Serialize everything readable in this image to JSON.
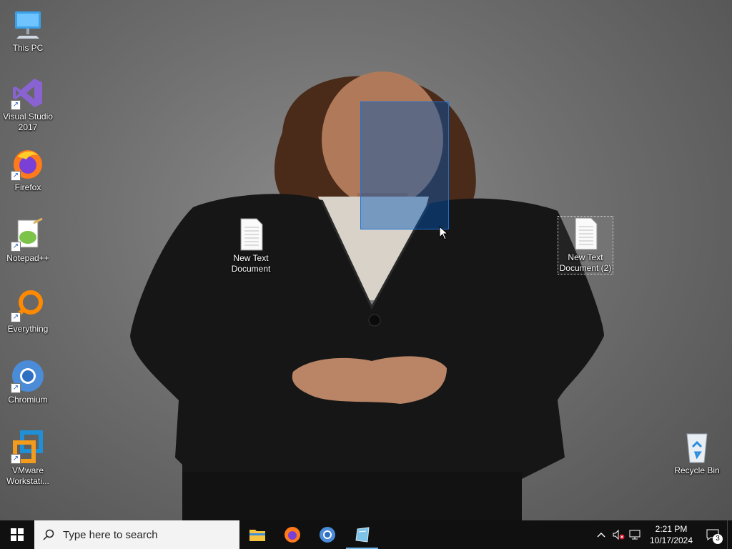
{
  "desktop": {
    "icons_left": [
      {
        "label": "This PC",
        "icon": "this-pc-icon"
      },
      {
        "label": "Visual Studio 2017",
        "icon": "visual-studio-icon"
      },
      {
        "label": "Firefox",
        "icon": "firefox-icon"
      },
      {
        "label": "Notepad++",
        "icon": "notepad-plus-plus-icon"
      },
      {
        "label": "Everything",
        "icon": "everything-search-icon"
      },
      {
        "label": "Chromium",
        "icon": "chromium-icon"
      },
      {
        "label": "VMware Workstati...",
        "icon": "vmware-icon"
      }
    ],
    "files": [
      {
        "label": "New Text Document",
        "icon": "text-document-icon"
      },
      {
        "label": "New Text Document (2)",
        "icon": "text-document-icon"
      }
    ],
    "recycle_bin": {
      "label": "Recycle Bin",
      "icon": "recycle-bin-icon"
    }
  },
  "taskbar": {
    "search_placeholder": "Type here to search",
    "pinned": [
      {
        "name": "File Explorer",
        "icon": "file-explorer-icon"
      },
      {
        "name": "Firefox",
        "icon": "firefox-icon"
      },
      {
        "name": "Chromium",
        "icon": "chromium-icon"
      },
      {
        "name": "App",
        "icon": "app-icon"
      }
    ],
    "clock": {
      "time": "2:21 PM",
      "date": "10/17/2024"
    },
    "notification_count": "3"
  },
  "colors": {
    "taskbar_bg": "#101010",
    "selection_fill": "#0054b4",
    "accent": "#76b9ed"
  }
}
